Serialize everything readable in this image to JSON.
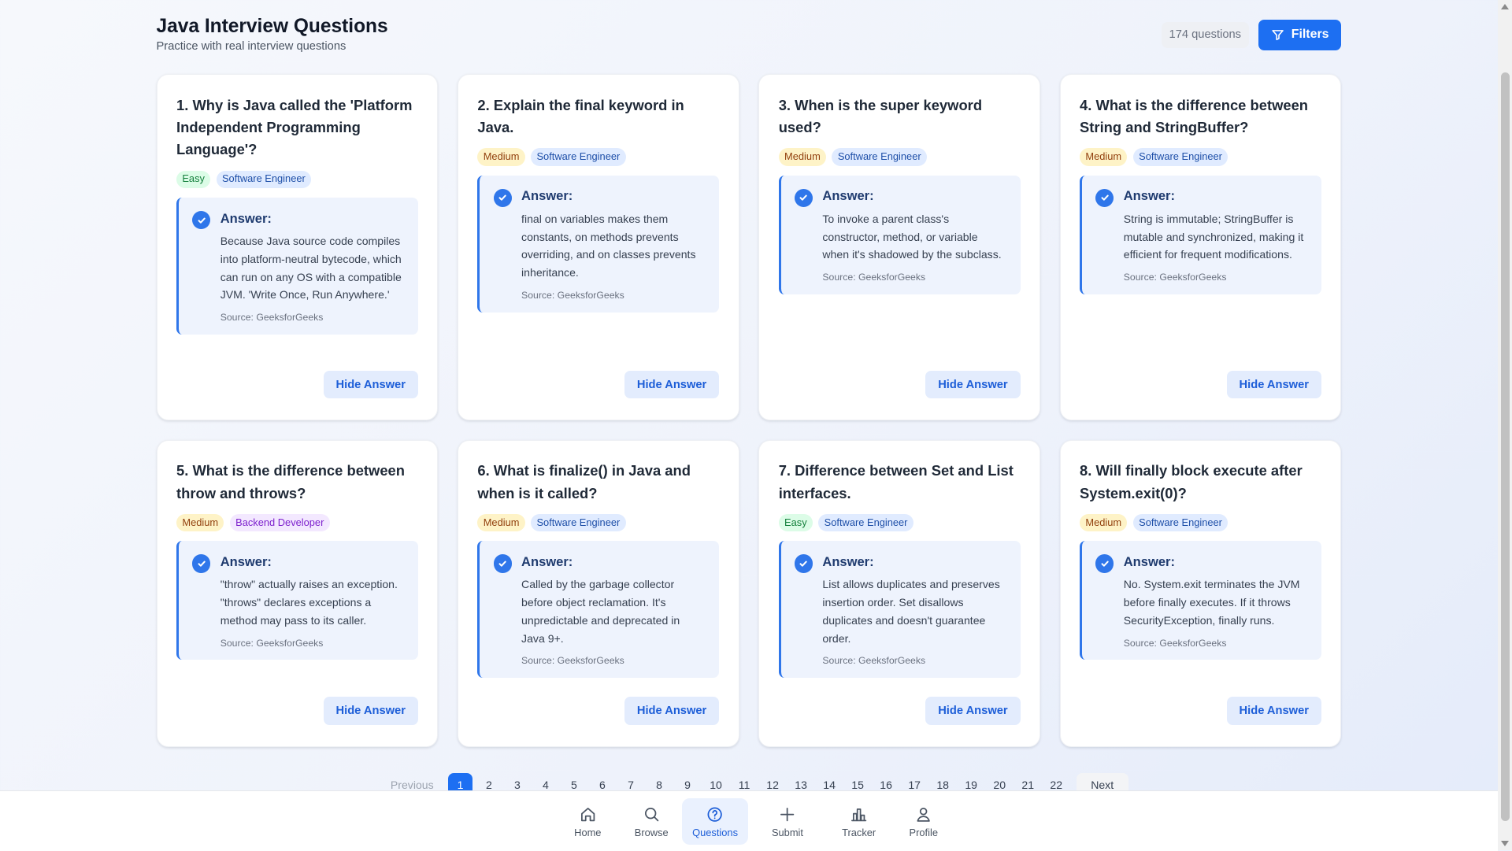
{
  "header": {
    "title": "Java Interview Questions",
    "subtitle": "Practice with real interview questions",
    "count": "174 questions",
    "filters_label": "Filters"
  },
  "answer_label": "Answer:",
  "hide_label": "Hide Answer",
  "cards": [
    {
      "title": "1. Why is Java called the 'Platform Independent Programming Language'?",
      "difficulty": "Easy",
      "role": "Software Engineer",
      "answer": "Because Java source code compiles into platform-neutral bytecode, which can run on any OS with a compatible JVM. 'Write Once, Run Anywhere.'",
      "source": "Source: GeeksforGeeks"
    },
    {
      "title": "2. Explain the final keyword in Java.",
      "difficulty": "Medium",
      "role": "Software Engineer",
      "answer": "final on variables makes them constants, on methods prevents overriding, and on classes prevents inheritance.",
      "source": "Source: GeeksforGeeks"
    },
    {
      "title": "3. When is the super keyword used?",
      "difficulty": "Medium",
      "role": "Software Engineer",
      "answer": "To invoke a parent class's constructor, method, or variable when it's shadowed by the subclass.",
      "source": "Source: GeeksforGeeks"
    },
    {
      "title": "4. What is the difference between String and StringBuffer?",
      "difficulty": "Medium",
      "role": "Software Engineer",
      "answer": "String is immutable; StringBuffer is mutable and synchronized, making it efficient for frequent modifications.",
      "source": "Source: GeeksforGeeks"
    },
    {
      "title": "5. What is the difference between throw and throws?",
      "difficulty": "Medium",
      "role": "Backend Developer",
      "answer": "\"throw\" actually raises an exception. \"throws\" declares exceptions a method may pass to its caller.",
      "source": "Source: GeeksforGeeks"
    },
    {
      "title": "6. What is finalize() in Java and when is it called?",
      "difficulty": "Medium",
      "role": "Software Engineer",
      "answer": "Called by the garbage collector before object reclamation. It's unpredictable and deprecated in Java 9+.",
      "source": "Source: GeeksforGeeks"
    },
    {
      "title": "7. Difference between Set and List interfaces.",
      "difficulty": "Easy",
      "role": "Software Engineer",
      "answer": "List allows duplicates and preserves insertion order. Set disallows duplicates and doesn't guarantee order.",
      "source": "Source: GeeksforGeeks"
    },
    {
      "title": "8. Will finally block execute after System.exit(0)?",
      "difficulty": "Medium",
      "role": "Software Engineer",
      "answer": "No. System.exit terminates the JVM before finally executes. If it throws SecurityException, finally runs.",
      "source": "Source: GeeksforGeeks"
    }
  ],
  "pagination": {
    "previous": "Previous",
    "next": "Next",
    "current": "1",
    "pages": [
      "1",
      "2",
      "3",
      "4",
      "5",
      "6",
      "7",
      "8",
      "9",
      "10",
      "11",
      "12",
      "13",
      "14",
      "15",
      "16",
      "17",
      "18",
      "19",
      "20",
      "21",
      "22"
    ]
  },
  "nav": {
    "active": "Questions",
    "items": [
      {
        "label": "Home",
        "icon": "home-icon"
      },
      {
        "label": "Browse",
        "icon": "search-icon"
      },
      {
        "label": "Questions",
        "icon": "help-circle-icon"
      },
      {
        "label": "Submit",
        "icon": "plus-icon"
      },
      {
        "label": "Tracker",
        "icon": "bar-chart-icon"
      },
      {
        "label": "Profile",
        "icon": "user-icon"
      }
    ]
  },
  "colors": {
    "accent": "#1d6ff2",
    "answer_bg": "#eef3fd",
    "easy": "#dcfce7",
    "medium": "#fef3c7"
  }
}
